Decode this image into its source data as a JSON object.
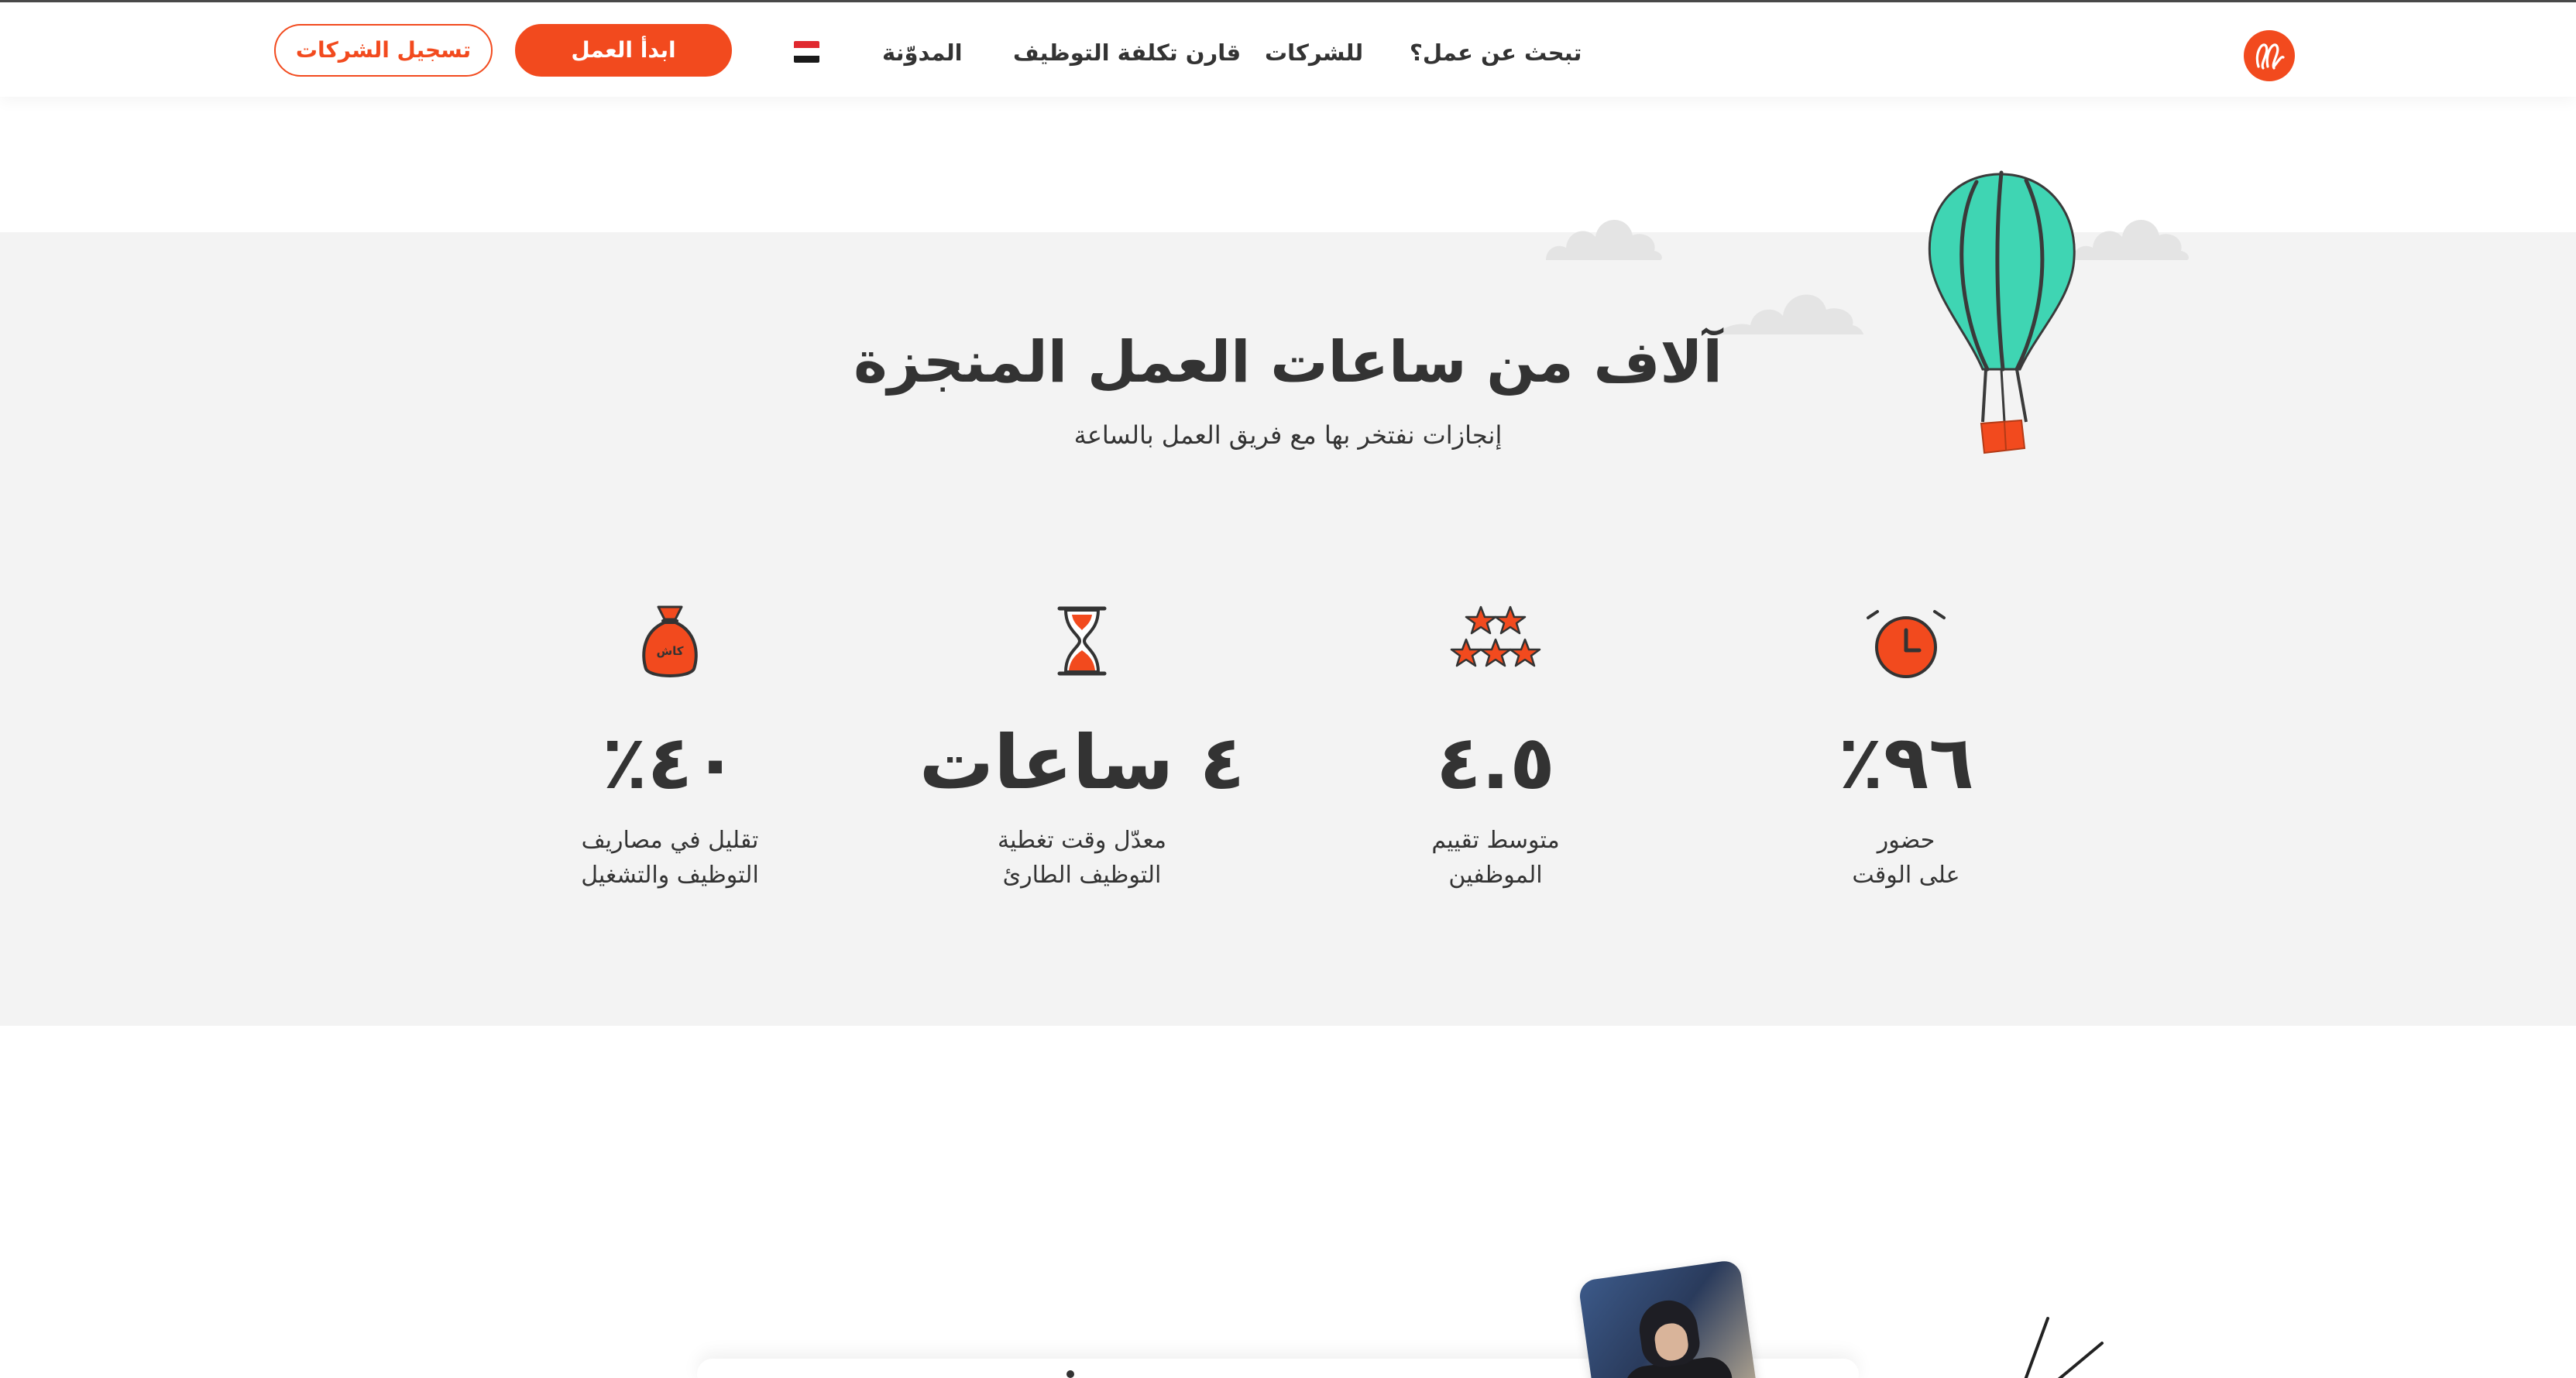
{
  "header": {
    "nav": {
      "find_job": "تبحث عن عمل؟",
      "for_companies": "للشركات",
      "compare_cost": "قارن تكلفة التوظيف",
      "blog": "المدوّنة"
    },
    "language_flag": "egypt-flag-icon",
    "start_work_label": "ابدأ العمل",
    "register_companies_label": "تسجيل الشركات",
    "colors": {
      "accent": "#f24a1e",
      "text": "#333333"
    }
  },
  "hero": {
    "title": "آلاف من ساعات العمل المنجزة",
    "subtitle": "إنجازات نفتخر بها مع فريق العمل بالساعة"
  },
  "stats": [
    {
      "icon": "alarm-clock-icon",
      "value": "٩٦٪",
      "label_line1": "حضور",
      "label_line2": "على الوقت"
    },
    {
      "icon": "stars-icon",
      "value": "٤.٥",
      "label_line1": "متوسط تقييم",
      "label_line2": "الموظفين"
    },
    {
      "icon": "hourglass-icon",
      "value": "٤ ساعات",
      "label_line1": "معدّل وقت تغطية",
      "label_line2": "التوظيف الطارئ"
    },
    {
      "icon": "money-bag-icon",
      "value": "٤٠٪",
      "label_line1": "تقليل في مصاريف",
      "label_line2": "التوظيف والتشغيل",
      "bag_text": "كاش"
    }
  ],
  "colors": {
    "band_background": "#f3f3f3",
    "balloon": "#3fd5b3",
    "accent": "#f24a1e"
  }
}
